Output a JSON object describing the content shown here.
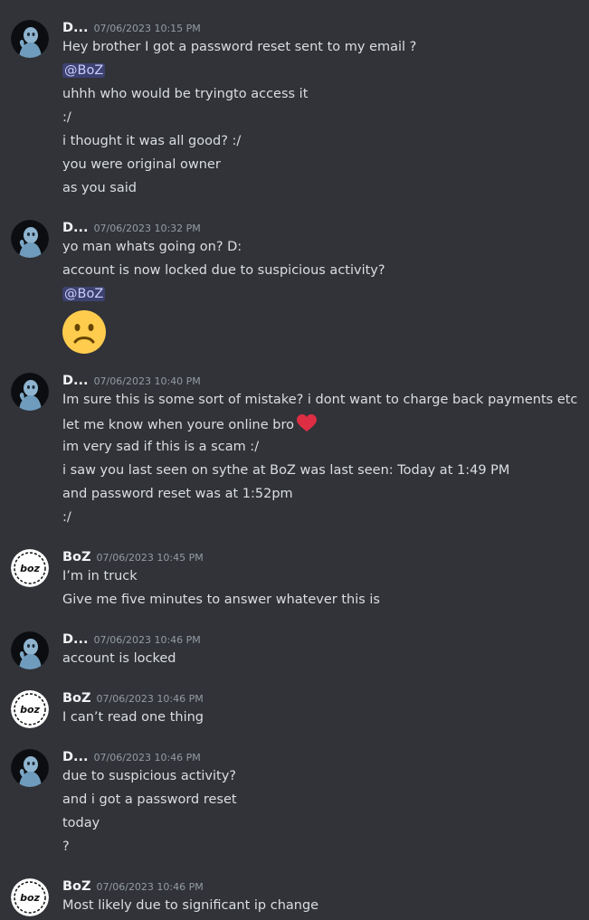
{
  "users": {
    "d": {
      "name": "D...",
      "avatar_icon": "blue-figure-avatar-icon"
    },
    "boz": {
      "name": "BoZ",
      "avatar_logo_text": "boz",
      "avatar_icon": "boz-logo-icon"
    }
  },
  "groups": [
    {
      "author": "D...",
      "time": "07/06/2023 10:15 PM",
      "lines": [
        "Hey brother I got a password reset sent to my email ?",
        "@BoZ",
        "uhhh who would be tryingto access it",
        ":/",
        "i thought it was all good? :/",
        "you were original owner",
        "as you said"
      ]
    },
    {
      "author": "D...",
      "time": "07/06/2023 10:32 PM",
      "lines": [
        "yo man whats going on? D:",
        "account is now locked due to suspicious activity?",
        "@BoZ"
      ],
      "emoji": "frowning-face-emoji"
    },
    {
      "author": "D...",
      "time": "07/06/2023 10:40 PM",
      "lines": [
        "Im sure this is some sort of mistake? i dont want to charge back payments etc",
        "let me know when youre online bro",
        "im very sad if this is a scam :/",
        "i saw you last seen on sythe at BoZ was last seen: Today at 1:49 PM",
        "and password reset was at 1:52pm",
        ":/"
      ],
      "inline_emoji": "red-heart-emoji"
    },
    {
      "author": "BoZ",
      "time": "07/06/2023 10:45 PM",
      "lines": [
        "I’m in truck",
        "Give me five minutes to answer whatever this is"
      ]
    },
    {
      "author": "D...",
      "time": "07/06/2023 10:46 PM",
      "lines": [
        "account is locked"
      ]
    },
    {
      "author": "BoZ",
      "time": "07/06/2023 10:46 PM",
      "lines": [
        "I can’t read one thing"
      ]
    },
    {
      "author": "D...",
      "time": "07/06/2023 10:46 PM",
      "lines": [
        "due to suspicious activity?",
        "and i got a password reset",
        "today",
        "?"
      ]
    },
    {
      "author": "BoZ",
      "time": "07/06/2023 10:46 PM",
      "lines": [
        "Most likely due to significant ip change"
      ]
    }
  ],
  "colors": {
    "background": "#313338",
    "text": "#dbdee1",
    "username": "#f2f3f5",
    "timestamp": "#949ba4",
    "mention_bg": "#3c4270",
    "mention_text": "#c9cdfb",
    "heart": "#dd2e44",
    "emoji_face": "#ffcc4d"
  }
}
